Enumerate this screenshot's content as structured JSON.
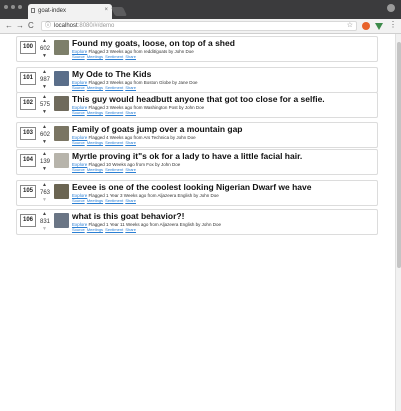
{
  "browser": {
    "tab_title": "goat-index",
    "tab_close": "×",
    "url_host": "localhost",
    "url_path": ":8080/#/demo",
    "back": "←",
    "forward": "→",
    "reload": "C",
    "info": "ⓘ",
    "star": "☆",
    "menu": "⋮"
  },
  "posts": [
    {
      "rank": "100",
      "score": "602",
      "title": "Found my goats, loose, on top of a shed",
      "src": "Flagged 3 Weeks ago from reddit/goats by John Doe",
      "thumb_color": "#7d7f6a",
      "down_faded": false
    },
    {
      "rank": "101",
      "score": "987",
      "title": "My Ode to The Kids",
      "src": "Flagged 3 Weeks ago from Boston Globe by Jane Doe",
      "thumb_color": "#5a6e8a",
      "down_faded": false
    },
    {
      "rank": "102",
      "score": "575",
      "title": "This guy would headbutt anyone that got too close for a selfie.",
      "src": "Flagged 3 Weeks ago from Washington Post by John Doe",
      "thumb_color": "#6f6a5c",
      "down_faded": false
    },
    {
      "rank": "103",
      "score": "602",
      "title": "Family of goats jump over a mountain gap",
      "src": "Flagged 4 Weeks ago from Ars Technica by John Doe",
      "thumb_color": "#7a7563",
      "down_faded": false
    },
    {
      "rank": "104",
      "score": "139",
      "title": "Myrtle proving it\"s ok for a lady to have a little facial hair.",
      "src": "Flagged 10 Weeks ago from Fox by John Doe",
      "thumb_color": "#b7b4ab",
      "down_faded": false
    },
    {
      "rank": "105",
      "score": "763",
      "title": "Eevee is one of the coolest looking Nigerian Dwarf we have",
      "src": "Flagged 1 Year 3 Weeks ago from Aljazeera English by John Doe",
      "thumb_color": "#6b6552",
      "down_faded": true
    },
    {
      "rank": "106",
      "score": "831",
      "title": "what is this goat behavior?!",
      "src": "Flagged 1 Year 11 Weeks ago from Aljazeera English by John Doe",
      "thumb_color": "#6a7585",
      "down_faded": true
    }
  ],
  "labels": {
    "source": "Explore",
    "actions": [
      "Source",
      "Meetings",
      "Sentiment",
      "Share"
    ],
    "upvote": "▲",
    "downvote": "▼"
  }
}
